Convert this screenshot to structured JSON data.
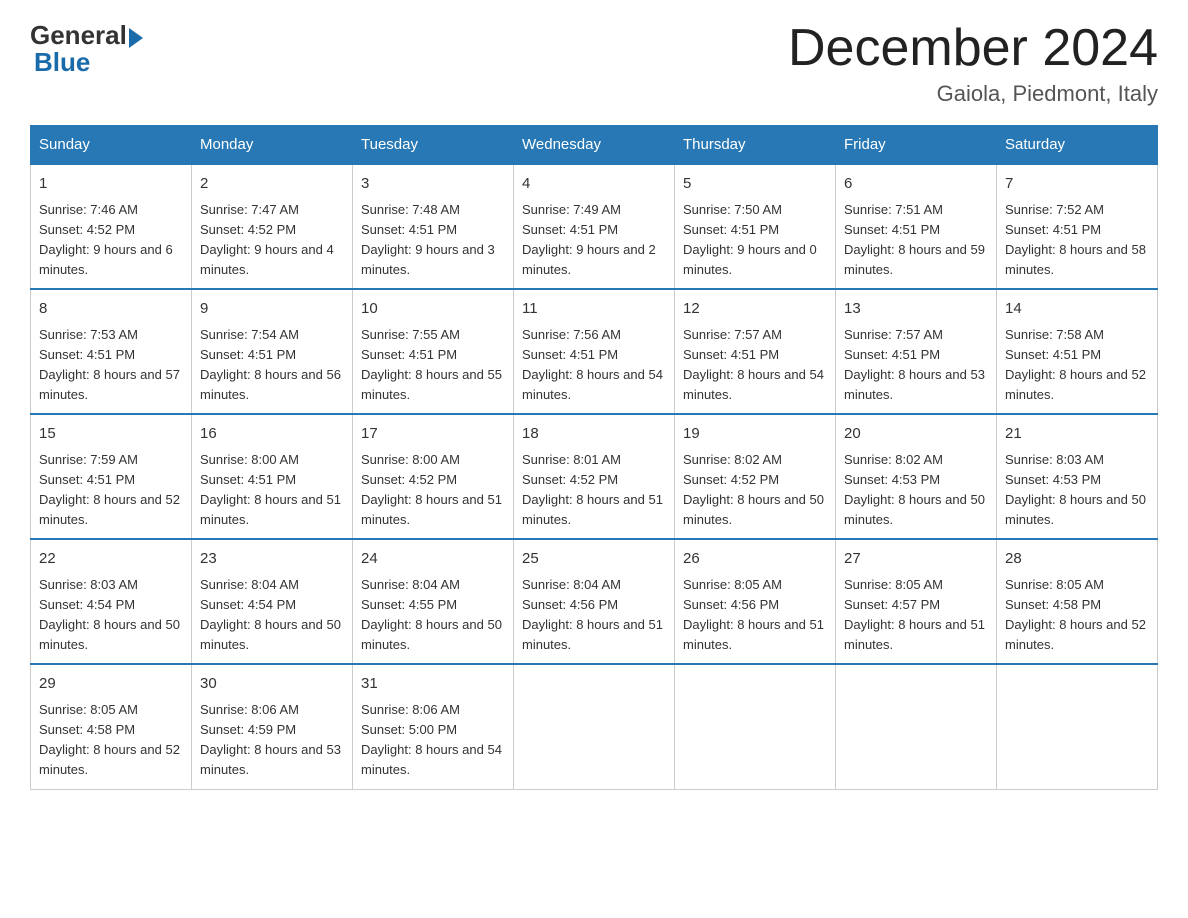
{
  "logo": {
    "general": "General",
    "blue": "Blue",
    "arrow_color": "#1a6baa"
  },
  "header": {
    "title": "December 2024",
    "subtitle": "Gaiola, Piedmont, Italy"
  },
  "weekdays": [
    "Sunday",
    "Monday",
    "Tuesday",
    "Wednesday",
    "Thursday",
    "Friday",
    "Saturday"
  ],
  "weeks": [
    [
      {
        "day": "1",
        "sunrise": "7:46 AM",
        "sunset": "4:52 PM",
        "daylight": "9 hours and 6 minutes."
      },
      {
        "day": "2",
        "sunrise": "7:47 AM",
        "sunset": "4:52 PM",
        "daylight": "9 hours and 4 minutes."
      },
      {
        "day": "3",
        "sunrise": "7:48 AM",
        "sunset": "4:51 PM",
        "daylight": "9 hours and 3 minutes."
      },
      {
        "day": "4",
        "sunrise": "7:49 AM",
        "sunset": "4:51 PM",
        "daylight": "9 hours and 2 minutes."
      },
      {
        "day": "5",
        "sunrise": "7:50 AM",
        "sunset": "4:51 PM",
        "daylight": "9 hours and 0 minutes."
      },
      {
        "day": "6",
        "sunrise": "7:51 AM",
        "sunset": "4:51 PM",
        "daylight": "8 hours and 59 minutes."
      },
      {
        "day": "7",
        "sunrise": "7:52 AM",
        "sunset": "4:51 PM",
        "daylight": "8 hours and 58 minutes."
      }
    ],
    [
      {
        "day": "8",
        "sunrise": "7:53 AM",
        "sunset": "4:51 PM",
        "daylight": "8 hours and 57 minutes."
      },
      {
        "day": "9",
        "sunrise": "7:54 AM",
        "sunset": "4:51 PM",
        "daylight": "8 hours and 56 minutes."
      },
      {
        "day": "10",
        "sunrise": "7:55 AM",
        "sunset": "4:51 PM",
        "daylight": "8 hours and 55 minutes."
      },
      {
        "day": "11",
        "sunrise": "7:56 AM",
        "sunset": "4:51 PM",
        "daylight": "8 hours and 54 minutes."
      },
      {
        "day": "12",
        "sunrise": "7:57 AM",
        "sunset": "4:51 PM",
        "daylight": "8 hours and 54 minutes."
      },
      {
        "day": "13",
        "sunrise": "7:57 AM",
        "sunset": "4:51 PM",
        "daylight": "8 hours and 53 minutes."
      },
      {
        "day": "14",
        "sunrise": "7:58 AM",
        "sunset": "4:51 PM",
        "daylight": "8 hours and 52 minutes."
      }
    ],
    [
      {
        "day": "15",
        "sunrise": "7:59 AM",
        "sunset": "4:51 PM",
        "daylight": "8 hours and 52 minutes."
      },
      {
        "day": "16",
        "sunrise": "8:00 AM",
        "sunset": "4:51 PM",
        "daylight": "8 hours and 51 minutes."
      },
      {
        "day": "17",
        "sunrise": "8:00 AM",
        "sunset": "4:52 PM",
        "daylight": "8 hours and 51 minutes."
      },
      {
        "day": "18",
        "sunrise": "8:01 AM",
        "sunset": "4:52 PM",
        "daylight": "8 hours and 51 minutes."
      },
      {
        "day": "19",
        "sunrise": "8:02 AM",
        "sunset": "4:52 PM",
        "daylight": "8 hours and 50 minutes."
      },
      {
        "day": "20",
        "sunrise": "8:02 AM",
        "sunset": "4:53 PM",
        "daylight": "8 hours and 50 minutes."
      },
      {
        "day": "21",
        "sunrise": "8:03 AM",
        "sunset": "4:53 PM",
        "daylight": "8 hours and 50 minutes."
      }
    ],
    [
      {
        "day": "22",
        "sunrise": "8:03 AM",
        "sunset": "4:54 PM",
        "daylight": "8 hours and 50 minutes."
      },
      {
        "day": "23",
        "sunrise": "8:04 AM",
        "sunset": "4:54 PM",
        "daylight": "8 hours and 50 minutes."
      },
      {
        "day": "24",
        "sunrise": "8:04 AM",
        "sunset": "4:55 PM",
        "daylight": "8 hours and 50 minutes."
      },
      {
        "day": "25",
        "sunrise": "8:04 AM",
        "sunset": "4:56 PM",
        "daylight": "8 hours and 51 minutes."
      },
      {
        "day": "26",
        "sunrise": "8:05 AM",
        "sunset": "4:56 PM",
        "daylight": "8 hours and 51 minutes."
      },
      {
        "day": "27",
        "sunrise": "8:05 AM",
        "sunset": "4:57 PM",
        "daylight": "8 hours and 51 minutes."
      },
      {
        "day": "28",
        "sunrise": "8:05 AM",
        "sunset": "4:58 PM",
        "daylight": "8 hours and 52 minutes."
      }
    ],
    [
      {
        "day": "29",
        "sunrise": "8:05 AM",
        "sunset": "4:58 PM",
        "daylight": "8 hours and 52 minutes."
      },
      {
        "day": "30",
        "sunrise": "8:06 AM",
        "sunset": "4:59 PM",
        "daylight": "8 hours and 53 minutes."
      },
      {
        "day": "31",
        "sunrise": "8:06 AM",
        "sunset": "5:00 PM",
        "daylight": "8 hours and 54 minutes."
      },
      null,
      null,
      null,
      null
    ]
  ],
  "labels": {
    "sunrise": "Sunrise:",
    "sunset": "Sunset:",
    "daylight": "Daylight:"
  }
}
